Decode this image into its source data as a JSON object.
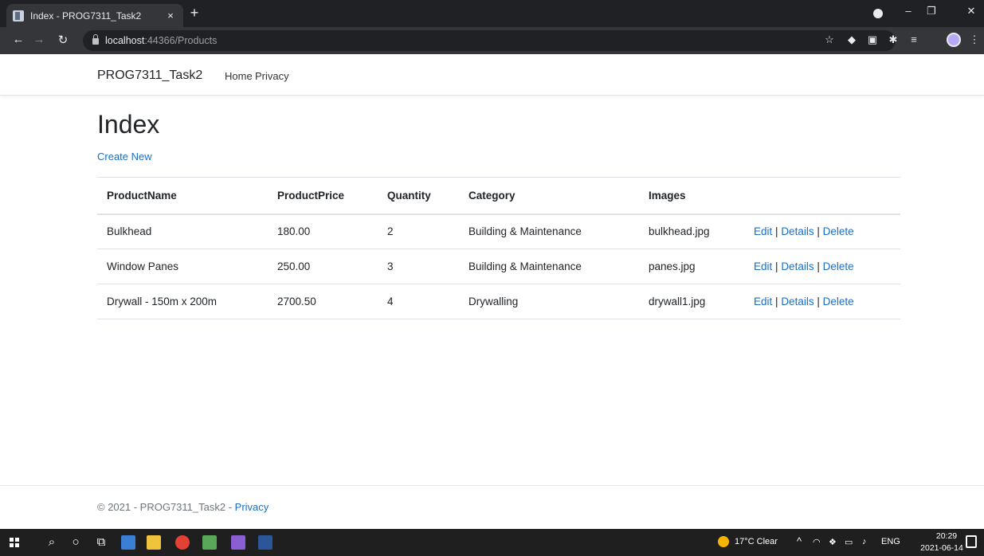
{
  "browser": {
    "tab_title": "Index - PROG7311_Task2",
    "tab_close": "×",
    "new_tab": "+",
    "url_host": "localhost",
    "url_path": ":44366/Products"
  },
  "site": {
    "brand": "PROG7311_Task2",
    "nav": [
      "Home",
      "Privacy"
    ]
  },
  "main": {
    "title": "Index",
    "create_link": "Create New",
    "columns": [
      "ProductName",
      "ProductPrice",
      "Quantity",
      "Category",
      "Images"
    ],
    "rows": [
      {
        "name": "Bulkhead",
        "price": "180.00",
        "qty": "2",
        "category": "Building & Maintenance",
        "image": "bulkhead.jpg"
      },
      {
        "name": "Window Panes",
        "price": "250.00",
        "qty": "3",
        "category": "Building & Maintenance",
        "image": "panes.jpg"
      },
      {
        "name": "Drywall - 150m x 200m",
        "price": "2700.50",
        "qty": "4",
        "category": "Drywalling",
        "image": "drywall1.jpg"
      }
    ],
    "actions": {
      "edit": "Edit",
      "details": "Details",
      "delete": "Delete",
      "separator": "|"
    }
  },
  "footer": {
    "text": "© 2021 - PROG7311_Task2 - ",
    "privacy_link": "Privacy"
  },
  "taskbar": {
    "weather": "17°C  Clear",
    "language": "ENG",
    "time": "20:29",
    "date": "2021-06-14"
  },
  "colors": {
    "link": "#1b6ec2",
    "chrome_dark": "#202124",
    "taskbar": "#1f1f1f"
  }
}
